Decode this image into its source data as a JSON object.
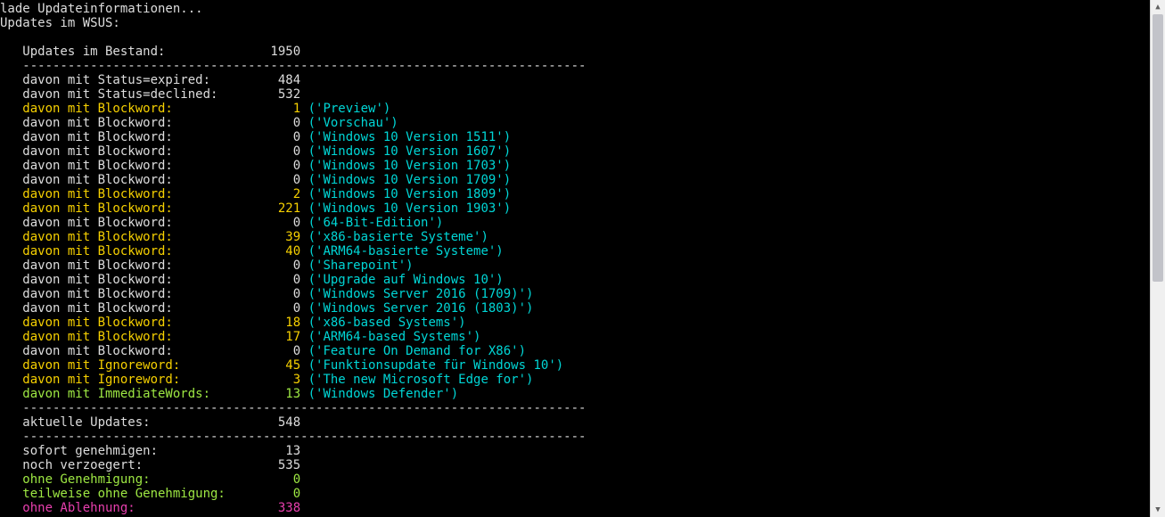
{
  "header": {
    "loading": "lade Updateinformationen...",
    "title": "Updates im WSUS:"
  },
  "bestand": {
    "label": "Updates im Bestand:",
    "value": "1950"
  },
  "separator": "---------------------------------------------------------------------------",
  "status": [
    {
      "label": "davon mit Status=expired:",
      "value": "484"
    },
    {
      "label": "davon mit Status=declined:",
      "value": "532"
    }
  ],
  "blockwords": [
    {
      "value": "1",
      "term": "('Preview')",
      "hi": true
    },
    {
      "value": "0",
      "term": "('Vorschau')",
      "hi": false
    },
    {
      "value": "0",
      "term": "('Windows 10 Version 1511')",
      "hi": false
    },
    {
      "value": "0",
      "term": "('Windows 10 Version 1607')",
      "hi": false
    },
    {
      "value": "0",
      "term": "('Windows 10 Version 1703')",
      "hi": false
    },
    {
      "value": "0",
      "term": "('Windows 10 Version 1709')",
      "hi": false
    },
    {
      "value": "2",
      "term": "('Windows 10 Version 1809')",
      "hi": true
    },
    {
      "value": "221",
      "term": "('Windows 10 Version 1903')",
      "hi": true
    },
    {
      "value": "0",
      "term": "('64-Bit-Edition')",
      "hi": false
    },
    {
      "value": "39",
      "term": "('x86-basierte Systeme')",
      "hi": true
    },
    {
      "value": "40",
      "term": "('ARM64-basierte Systeme')",
      "hi": true
    },
    {
      "value": "0",
      "term": "('Sharepoint')",
      "hi": false
    },
    {
      "value": "0",
      "term": "('Upgrade auf Windows 10')",
      "hi": false
    },
    {
      "value": "0",
      "term": "('Windows Server 2016 (1709)')",
      "hi": false
    },
    {
      "value": "0",
      "term": "('Windows Server 2016 (1803)')",
      "hi": false
    },
    {
      "value": "18",
      "term": "('x86-based Systems')",
      "hi": true
    },
    {
      "value": "17",
      "term": "('ARM64-based Systems')",
      "hi": true
    },
    {
      "value": "0",
      "term": "('Feature On Demand for X86')",
      "hi": false
    }
  ],
  "ignorewords": [
    {
      "value": "45",
      "term": "('Funktionsupdate für Windows 10')",
      "hi": true
    },
    {
      "value": "3",
      "term": "('The new Microsoft Edge for')",
      "hi": true
    }
  ],
  "immediate": {
    "label": "davon mit ImmediateWords:",
    "value": "13",
    "term": "('Windows Defender')"
  },
  "blockword_label": "davon mit Blockword:",
  "ignoreword_label": "davon mit Ignoreword:",
  "aktuelle": {
    "label": "aktuelle Updates:",
    "value": "548"
  },
  "summary": {
    "sofort": {
      "label": "sofort genehmigen:",
      "value": "13"
    },
    "verzoegert": {
      "label": "noch verzoegert:",
      "value": "535"
    },
    "ohne_gen": {
      "label": "ohne Genehmigung:",
      "value": "0"
    },
    "teil_gen": {
      "label": "teilweise ohne Genehmigung:",
      "value": "0"
    },
    "ohne_abl": {
      "label": "ohne Ablehnung:",
      "value": "338"
    }
  }
}
